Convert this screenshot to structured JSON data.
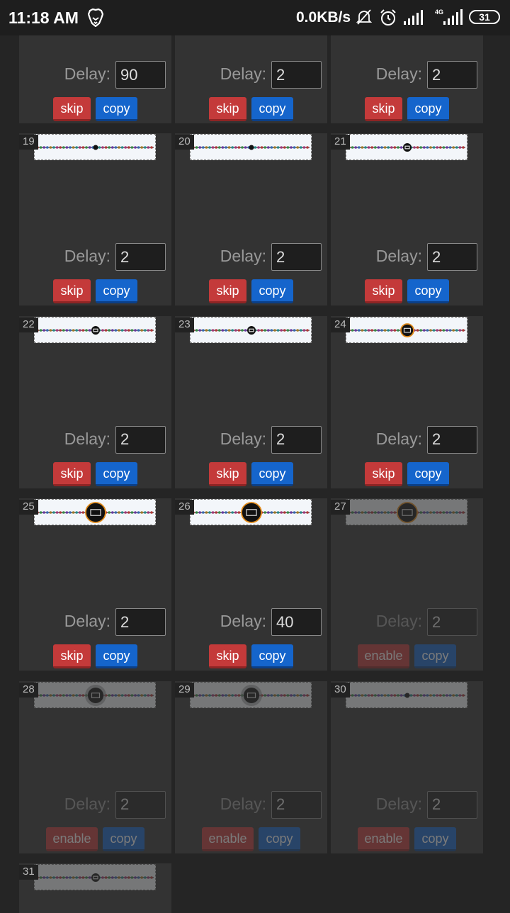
{
  "status_bar": {
    "time": "11:18 AM",
    "network_speed": "0.0KB/s",
    "network_type": "4G",
    "battery": "31",
    "icons": [
      "brave-lion-icon",
      "mute-bell-icon",
      "alarm-clock-icon",
      "signal-icon",
      "signal-4g-icon",
      "battery-icon"
    ]
  },
  "labels": {
    "delay": "Delay:",
    "skip": "skip",
    "copy": "copy",
    "enable": "enable"
  },
  "colors": {
    "skip": "#c43a3a",
    "copy": "#1565cc",
    "frame_bg": "#333333",
    "page_bg": "#252525"
  },
  "frames": [
    {
      "number": "",
      "delay": "90",
      "disabled": false,
      "partial": true,
      "eye": "none"
    },
    {
      "number": "",
      "delay": "2",
      "disabled": false,
      "partial": true,
      "eye": "none"
    },
    {
      "number": "",
      "delay": "2",
      "disabled": false,
      "partial": true,
      "eye": "none"
    },
    {
      "number": "19",
      "delay": "2",
      "disabled": false,
      "eye": "dot"
    },
    {
      "number": "20",
      "delay": "2",
      "disabled": false,
      "eye": "dot"
    },
    {
      "number": "21",
      "delay": "2",
      "disabled": false,
      "eye": "small"
    },
    {
      "number": "22",
      "delay": "2",
      "disabled": false,
      "eye": "small"
    },
    {
      "number": "23",
      "delay": "2",
      "disabled": false,
      "eye": "small"
    },
    {
      "number": "24",
      "delay": "2",
      "disabled": false,
      "eye": "medium"
    },
    {
      "number": "25",
      "delay": "2",
      "disabled": false,
      "eye": "large"
    },
    {
      "number": "26",
      "delay": "40",
      "disabled": false,
      "eye": "large"
    },
    {
      "number": "27",
      "delay": "2",
      "disabled": true,
      "eye": "large"
    },
    {
      "number": "28",
      "delay": "2",
      "disabled": true,
      "eye": "glow"
    },
    {
      "number": "29",
      "delay": "2",
      "disabled": true,
      "eye": "glow"
    },
    {
      "number": "30",
      "delay": "2",
      "disabled": true,
      "eye": "dot"
    },
    {
      "number": "31",
      "delay": "",
      "disabled": true,
      "partial_bottom": true,
      "eye": "small"
    }
  ]
}
